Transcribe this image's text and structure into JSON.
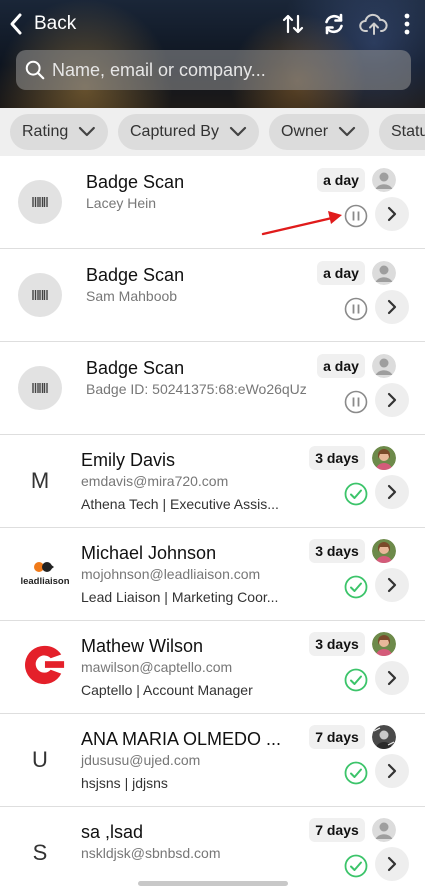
{
  "header": {
    "back_label": "Back",
    "icons": [
      "sort-icon",
      "refresh-icon",
      "cloud-upload-icon",
      "more-vert-icon"
    ],
    "search_placeholder": "Name, email or company..."
  },
  "filters": [
    {
      "label": "Rating"
    },
    {
      "label": "Captured By"
    },
    {
      "label": "Owner"
    },
    {
      "label": "Statu"
    }
  ],
  "rows": [
    {
      "type": "badge",
      "title": "Badge Scan",
      "subtitle": "Lacey Hein",
      "time": "a day",
      "status": "paused"
    },
    {
      "type": "badge",
      "title": "Badge Scan",
      "subtitle": "Sam Mahboob",
      "time": "a day",
      "status": "paused"
    },
    {
      "type": "badge",
      "title": "Badge Scan",
      "subtitle": "Badge ID: 50241375:68:eWo26qUz",
      "time": "a day",
      "status": "paused"
    },
    {
      "type": "contact",
      "initial": "M",
      "name": "Emily Davis",
      "email": "emdavis@mira720.com",
      "company": "Athena Tech | Executive Assis...",
      "time": "3 days",
      "status": "done"
    },
    {
      "type": "contact",
      "logo": "leadliaison",
      "logo_text": "leadliaison",
      "name": "Michael Johnson",
      "email": "mojohnson@leadliaison.com",
      "company": "Lead Liaison | Marketing Coor...",
      "time": "3 days",
      "status": "done"
    },
    {
      "type": "contact",
      "logo": "captello",
      "name": "Mathew Wilson",
      "email": "mawilson@captello.com",
      "company": "Captello | Account Manager",
      "time": "3 days",
      "status": "done"
    },
    {
      "type": "contact",
      "initial": "U",
      "name": "ANA MARIA OLMEDO ...",
      "email": "jdususu@ujed.com",
      "company": "hsjsns | jdjsns",
      "time": "7 days",
      "status": "done"
    },
    {
      "type": "contact",
      "initial": "S",
      "name": "sa ,lsad",
      "email": "nskldjsk@sbnbsd.com",
      "company": "",
      "time": "7 days",
      "status": "done"
    }
  ],
  "colors": {
    "accent_green": "#3cc46a",
    "annotation_red": "#e01b1b",
    "chip_bg": "#dcdcdc",
    "filter_bar_bg": "#efefef"
  }
}
